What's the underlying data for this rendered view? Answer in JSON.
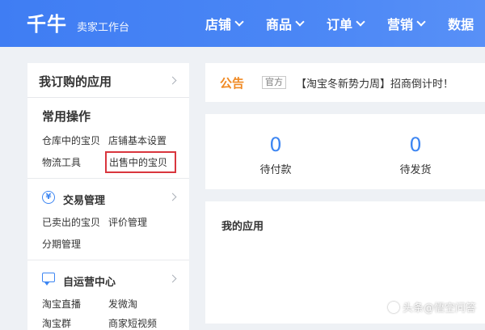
{
  "header": {
    "logo": "千牛",
    "subtitle": "卖家工作台",
    "nav": [
      {
        "label": "店铺"
      },
      {
        "label": "商品"
      },
      {
        "label": "订单"
      },
      {
        "label": "营销"
      },
      {
        "label": "数据"
      }
    ]
  },
  "sidebar": {
    "title": "我订购的应用",
    "common": {
      "title": "常用操作",
      "links": [
        "仓库中的宝贝",
        "店铺基本设置",
        "物流工具",
        "出售中的宝贝"
      ]
    },
    "groups": [
      {
        "title": "交易管理",
        "icon": "yen-icon",
        "links": [
          "已卖出的宝贝",
          "评价管理",
          "分期管理"
        ]
      },
      {
        "title": "自运营中心",
        "icon": "chat-icon",
        "links": [
          "淘宝直播",
          "发微淘",
          "淘宝群",
          "商家短视频"
        ]
      }
    ]
  },
  "notice": {
    "title": "公告",
    "tag": "官方",
    "text": "【淘宝冬新势力周】招商倒计时！"
  },
  "stats": [
    {
      "value": "0",
      "label": "待付款"
    },
    {
      "value": "0",
      "label": "待发货"
    }
  ],
  "apps": {
    "title": "我的应用"
  },
  "watermark": {
    "text": "头条@悟空问答"
  },
  "colors": {
    "header": "#4a86f5",
    "accent": "#3d86f2",
    "notice": "#f08a24",
    "highlight": "#d9363e"
  }
}
